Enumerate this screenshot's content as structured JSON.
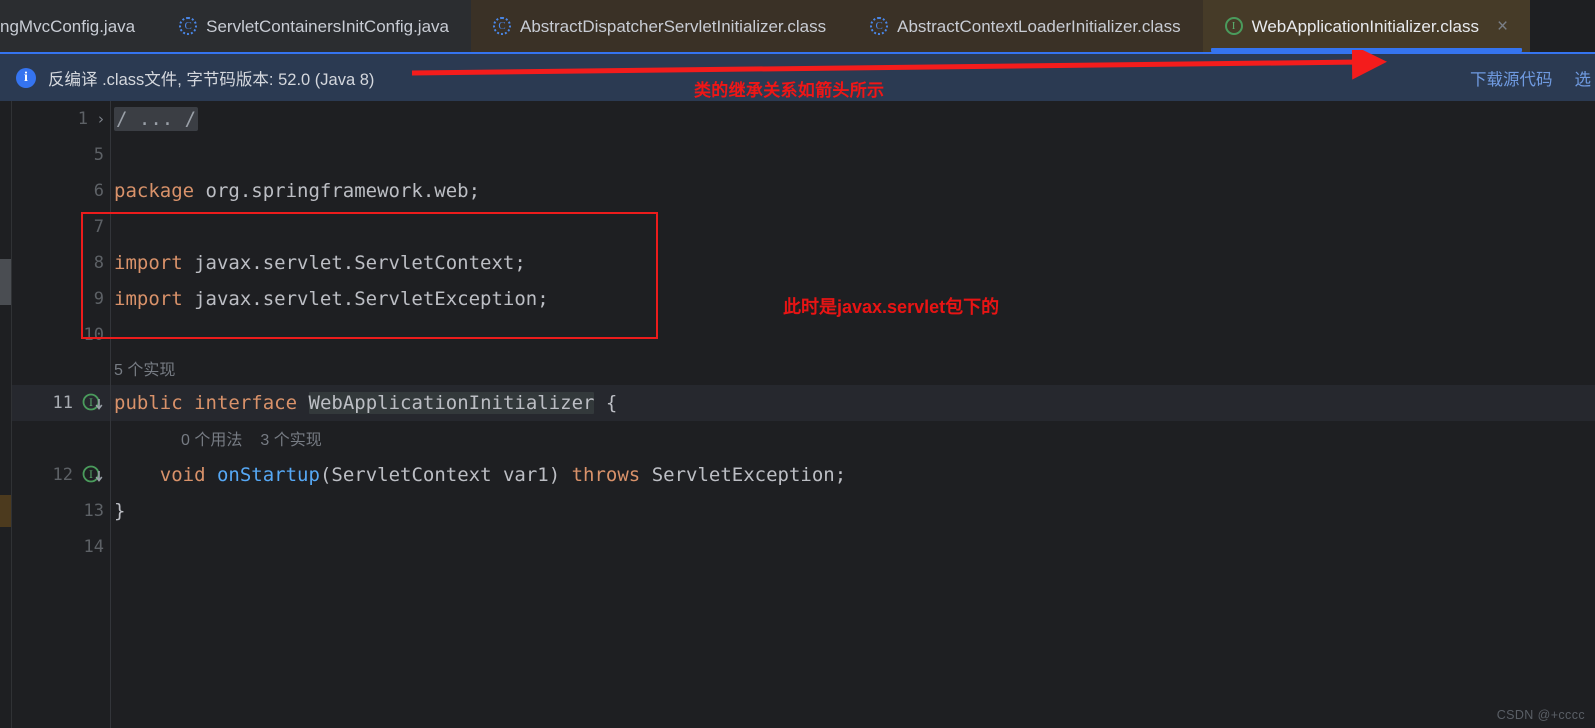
{
  "window": {
    "watermark": "CSDN @+cccc"
  },
  "tabbar": {
    "tabs": [
      {
        "label": "ngMvcConfig.java",
        "icon": "",
        "icon_kind": "none",
        "state": "clipped",
        "closable": false
      },
      {
        "label": "ServletContainersInitConfig.java",
        "icon": "C",
        "icon_kind": "class",
        "state": "inactive",
        "closable": false
      },
      {
        "label": "AbstractDispatcherServletInitializer.class",
        "icon": "C",
        "icon_kind": "class",
        "state": "brown",
        "closable": false
      },
      {
        "label": "AbstractContextLoaderInitializer.class",
        "icon": "C",
        "icon_kind": "class",
        "state": "brown",
        "closable": false
      },
      {
        "label": "WebApplicationInitializer.class",
        "icon": "I",
        "icon_kind": "interface",
        "state": "active",
        "closable": true,
        "close_label": "×"
      }
    ]
  },
  "notification": {
    "icon": "info-icon",
    "icon_glyph": "i",
    "message": "反编译 .class文件, 字节码版本: 52.0 (Java 8)",
    "actions": [
      {
        "label": "下载源代码"
      },
      {
        "label": "选"
      }
    ]
  },
  "annotations": {
    "arrow_label": "类的继承关系如箭头所示",
    "javax_label": "此时是javax.servlet包下的",
    "arrow_color": "#ec1c1c",
    "box_color": "#ec1c1c"
  },
  "editor": {
    "gutter": [
      {
        "lineno": "1",
        "fold": "›",
        "impl_icon": false,
        "highlight": false
      },
      {
        "lineno": "5",
        "fold": "",
        "impl_icon": false,
        "highlight": false
      },
      {
        "lineno": "6",
        "fold": "",
        "impl_icon": false,
        "highlight": false
      },
      {
        "lineno": "7",
        "fold": "",
        "impl_icon": false,
        "highlight": false
      },
      {
        "lineno": "8",
        "fold": "",
        "impl_icon": false,
        "highlight": false
      },
      {
        "lineno": "9",
        "fold": "",
        "impl_icon": false,
        "highlight": false
      },
      {
        "lineno": "10",
        "fold": "",
        "impl_icon": false,
        "highlight": false
      },
      {
        "lineno": "11",
        "fold": "",
        "impl_icon": true,
        "highlight": true
      },
      {
        "lineno": "12",
        "fold": "",
        "impl_icon": true,
        "highlight": false
      },
      {
        "lineno": "13",
        "fold": "",
        "impl_icon": false,
        "highlight": false
      },
      {
        "lineno": "14",
        "fold": "",
        "impl_icon": false,
        "highlight": false
      }
    ],
    "lines": {
      "l1_fold": "/ ... /",
      "l6_kw": "package",
      "l6_rest": " org.springframework.web;",
      "l8_kw": "import",
      "l8_rest": " javax.servlet.ServletContext;",
      "l9_kw": "import",
      "l9_rest": " javax.servlet.ServletException;",
      "l11_kw1": "public",
      "l11_kw2": "interface",
      "l11_name": "WebApplicationInitializer",
      "l11_brace": " {",
      "l12_kw1": "void",
      "l12_meth": "onStartup",
      "l12_params": "(ServletContext var1) ",
      "l12_kw2": "throws",
      "l12_rest": " ServletException;",
      "l13_brace": "}"
    },
    "code_vision": {
      "interface_implementations": "5 个实现",
      "method_usages": "0 个用法",
      "method_implementations": "3 个实现"
    }
  }
}
